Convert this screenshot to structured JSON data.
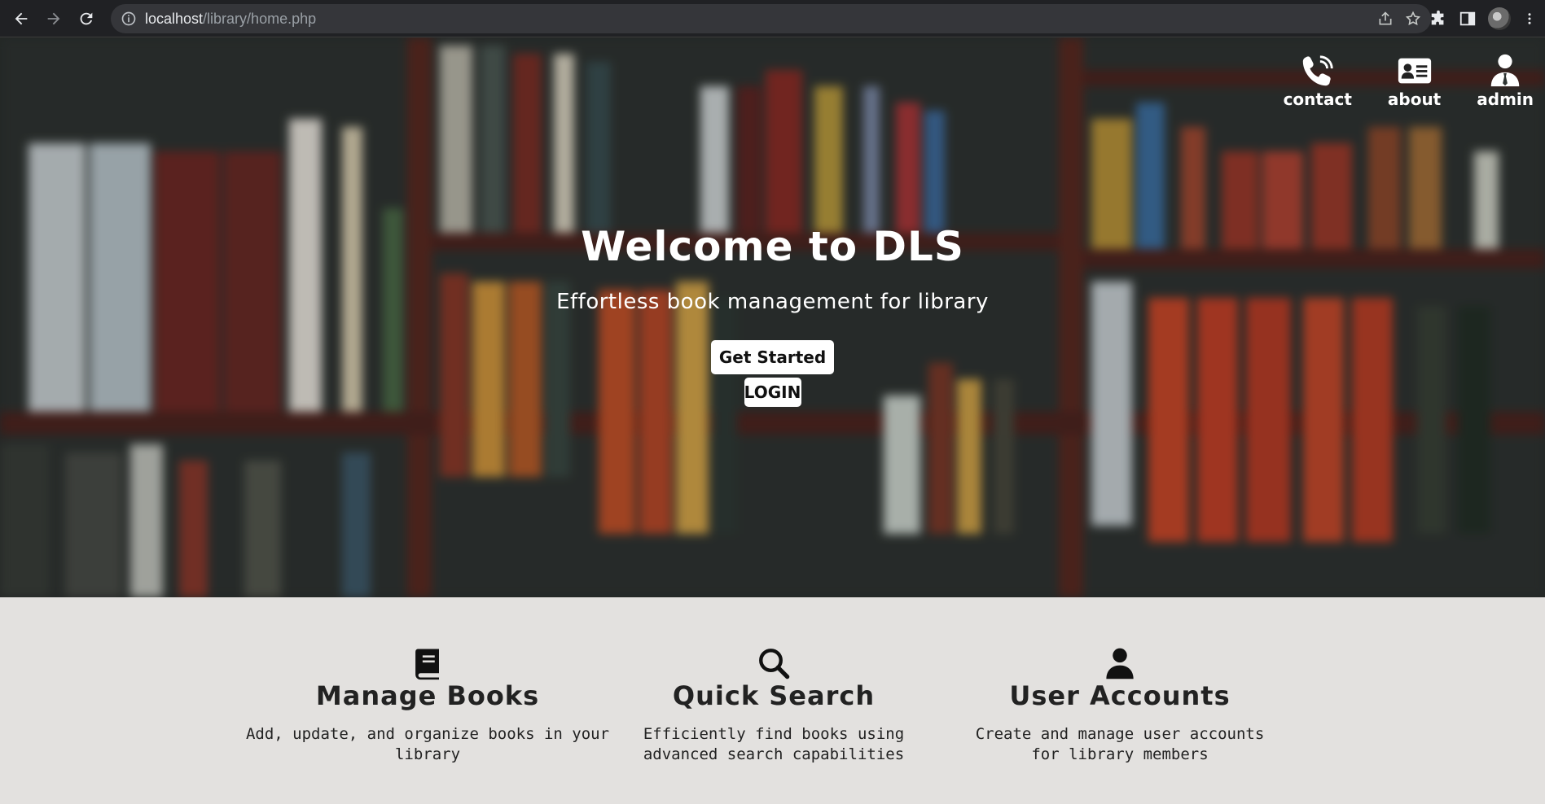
{
  "browser": {
    "url_host": "localhost",
    "url_path": "/library/home.php"
  },
  "topnav": {
    "contact": "contact",
    "about": "about",
    "admin": "admin"
  },
  "hero": {
    "title": "Welcome to DLS",
    "subtitle": "Effortless book management for library",
    "get_started": "Get Started",
    "login": "LOGIN"
  },
  "features": [
    {
      "title": "Manage Books",
      "description": "Add, update, and organize books in your library",
      "icon": "book-icon"
    },
    {
      "title": "Quick Search",
      "description": "Efficiently find books using advanced search capabilities",
      "icon": "search-icon"
    },
    {
      "title": "User Accounts",
      "description": "Create and manage user accounts for library members",
      "icon": "user-icon"
    }
  ]
}
